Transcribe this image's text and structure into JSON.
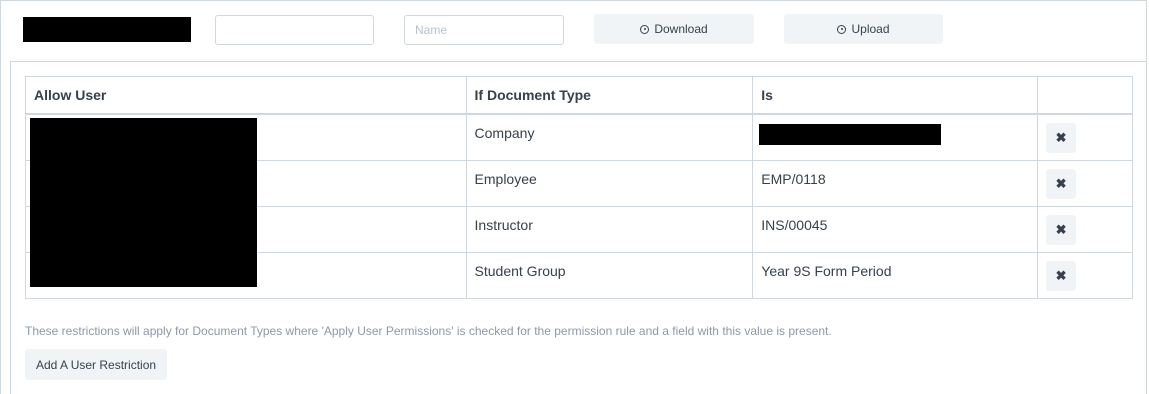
{
  "toolbar": {
    "field_value": "",
    "name_placeholder": "Name",
    "download_label": "Download",
    "upload_label": "Upload",
    "download_icon": "circle-dot-icon",
    "upload_icon": "circle-dot-icon"
  },
  "table": {
    "headers": [
      "Allow User",
      "If Document Type",
      "Is",
      ""
    ],
    "rows": [
      {
        "doctype": "Company",
        "value": ""
      },
      {
        "doctype": "Employee",
        "value": "EMP/0118"
      },
      {
        "doctype": "Instructor",
        "value": "INS/00045"
      },
      {
        "doctype": "Student Group",
        "value": "Year 9S Form Period"
      }
    ],
    "remove_glyph": "✖"
  },
  "help_text": "These restrictions will apply for Document Types where 'Apply User Permissions' is checked for the permission rule and a field with this value is present.",
  "add_button_label": "Add A User Restriction"
}
